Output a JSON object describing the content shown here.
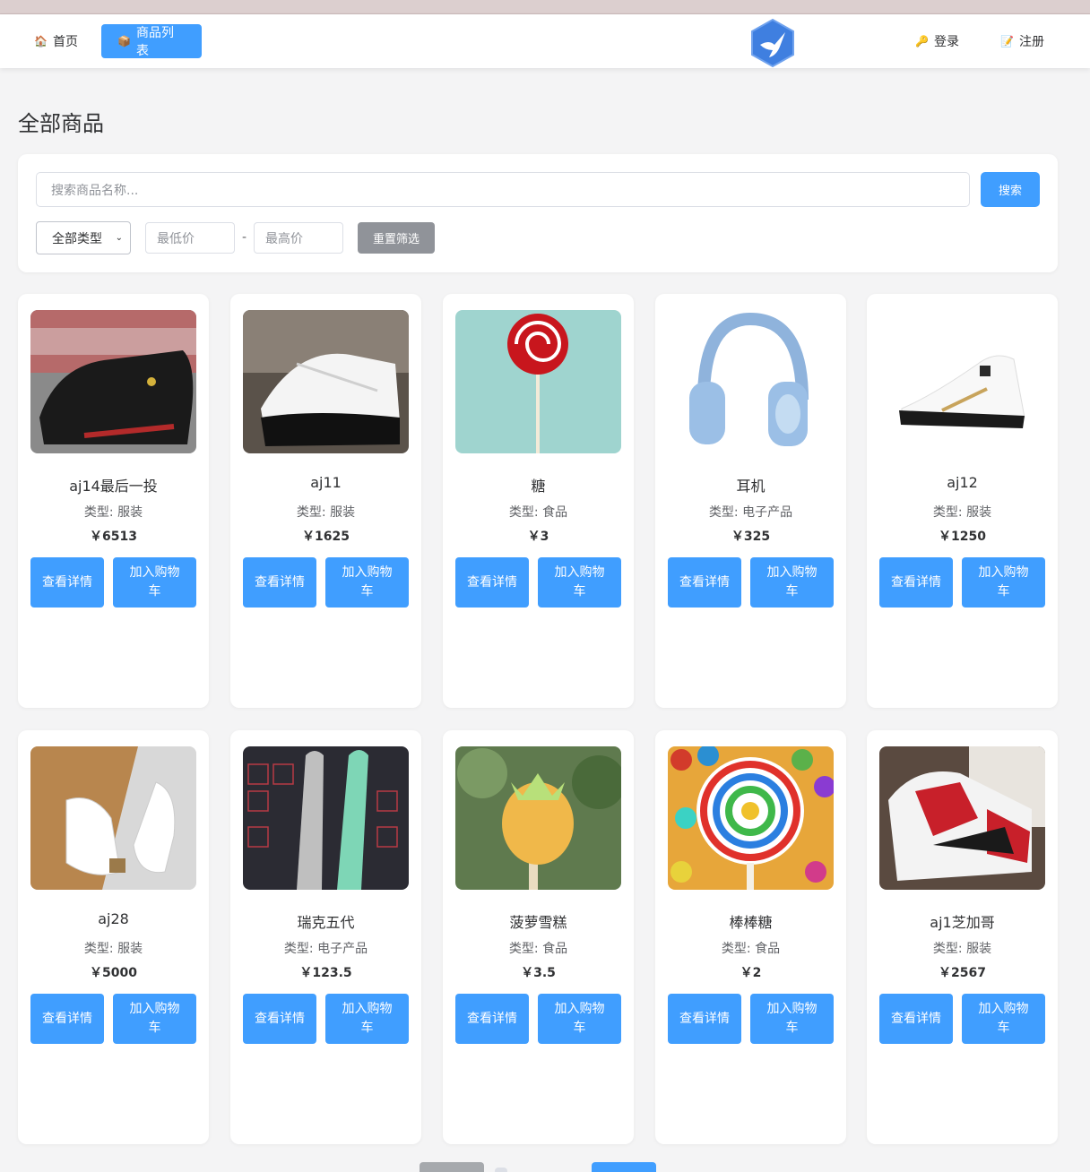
{
  "nav": {
    "home_label": "首页",
    "products_label": "商品列表",
    "login_label": "登录",
    "register_label": "注册",
    "home_icon": "house-icon",
    "products_icon": "package-icon",
    "login_icon": "key-icon",
    "register_icon": "memo-icon"
  },
  "page_title": "全部商品",
  "filter": {
    "search_placeholder": "搜索商品名称...",
    "search_button": "搜索",
    "type_selected": "全部类型",
    "min_price_placeholder": "最低价",
    "separator": "-",
    "max_price_placeholder": "最高价",
    "reset_button": "重置筛选"
  },
  "products": [
    {
      "name": "aj14最后一投",
      "type": "类型: 服装",
      "price": "￥6513",
      "detail": "查看详情",
      "cart": "加入购物车"
    },
    {
      "name": "aj11",
      "type": "类型: 服装",
      "price": "￥1625",
      "detail": "查看详情",
      "cart": "加入购物车"
    },
    {
      "name": "糖",
      "type": "类型: 食品",
      "price": "￥3",
      "detail": "查看详情",
      "cart": "加入购物车"
    },
    {
      "name": "耳机",
      "type": "类型: 电子产品",
      "price": "￥325",
      "detail": "查看详情",
      "cart": "加入购物车"
    },
    {
      "name": "aj12",
      "type": "类型: 服装",
      "price": "￥1250",
      "detail": "查看详情",
      "cart": "加入购物车"
    },
    {
      "name": "aj28",
      "type": "类型: 服装",
      "price": "￥5000",
      "detail": "查看详情",
      "cart": "加入购物车"
    },
    {
      "name": "瑞克五代",
      "type": "类型: 电子产品",
      "price": "￥123.5",
      "detail": "查看详情",
      "cart": "加入购物车"
    },
    {
      "name": "菠萝雪糕",
      "type": "类型: 食品",
      "price": "￥3.5",
      "detail": "查看详情",
      "cart": "加入购物车"
    },
    {
      "name": "棒棒糖",
      "type": "类型: 食品",
      "price": "￥2",
      "detail": "查看详情",
      "cart": "加入购物车"
    },
    {
      "name": "aj1芝加哥",
      "type": "类型: 服装",
      "price": "￥2567",
      "detail": "查看详情",
      "cart": "加入购物车"
    }
  ],
  "colors": {
    "primary": "#409eff",
    "muted_button": "#909399",
    "background": "#f4f4f5"
  }
}
